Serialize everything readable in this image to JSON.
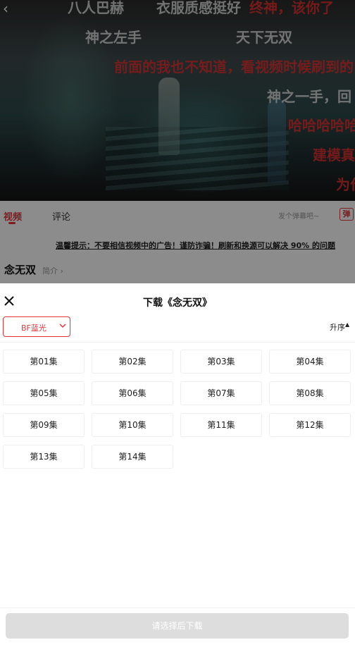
{
  "danmu": [
    {
      "text": "八人巴赫",
      "color": "white"
    },
    {
      "text": "衣服质感挺好",
      "color": "white"
    },
    {
      "text": "终神，该你了",
      "color": "red"
    },
    {
      "text": "神之左手",
      "color": "white"
    },
    {
      "text": "天下无双",
      "color": "white"
    },
    {
      "text": "前面的我也不知道，看视频时候刷到的",
      "color": "red"
    },
    {
      "text": "神之一手，回",
      "color": "white"
    },
    {
      "text": "哈哈哈哈哈",
      "color": "red"
    },
    {
      "text": "建模真",
      "color": "red"
    },
    {
      "text": "为什",
      "color": "red"
    }
  ],
  "tabs": {
    "video": "视频",
    "comment": "评论"
  },
  "danmu_input_placeholder": "发个弹幕吧~",
  "danmu_toggle_label": "弹",
  "notice": "温馨提示：不要相信视频中的广告！谨防诈骗！刷新和换源可以解决 90% 的问题",
  "show": {
    "title": "念无双",
    "intro_link": "简介"
  },
  "panel": {
    "title": "下载《念无双》",
    "quality": "BF蓝光",
    "sort_label": "升序"
  },
  "episodes": [
    "第01集",
    "第02集",
    "第03集",
    "第04集",
    "第05集",
    "第06集",
    "第07集",
    "第08集",
    "第09集",
    "第10集",
    "第11集",
    "第12集",
    "第13集",
    "第14集"
  ],
  "download_button": "请选择后下载",
  "colors": {
    "accent": "#e5333a",
    "disabled_button": "#dddddd"
  }
}
